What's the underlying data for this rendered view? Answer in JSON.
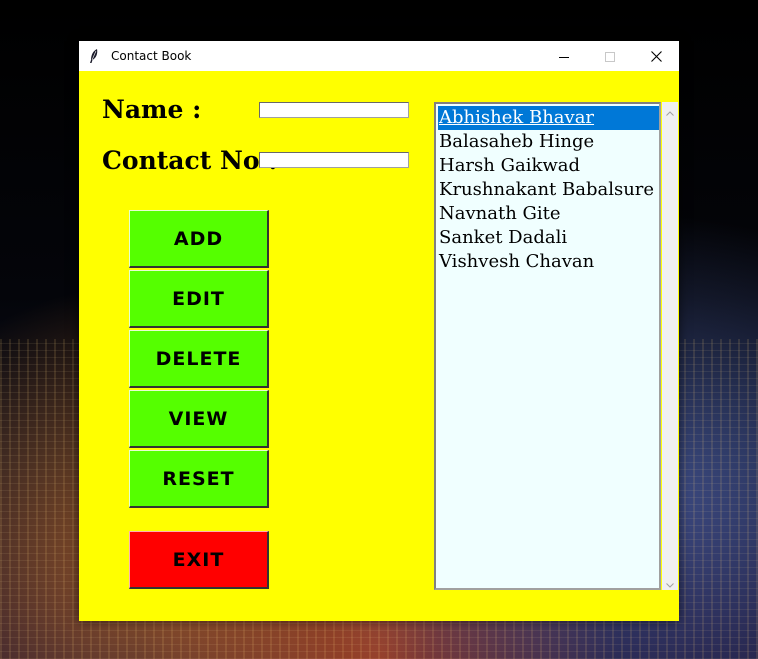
{
  "window": {
    "title": "Contact Book",
    "icon": "feather-icon",
    "controls": {
      "minimize": "minimize-icon",
      "maximize": "maximize-icon",
      "close": "close-icon"
    }
  },
  "form": {
    "name_label": "Name :",
    "name_value": "",
    "contact_label": "Contact No :",
    "contact_value": ""
  },
  "buttons": {
    "add": "ADD",
    "edit": "EDIT",
    "delete": "DELETE",
    "view": "VIEW",
    "reset": "RESET",
    "exit": "EXIT"
  },
  "contacts": {
    "selected_index": 0,
    "items": [
      "Abhishek Bhavar",
      "Balasaheb Hinge",
      "Harsh Gaikwad",
      "Krushnakant Babalsure",
      "Navnath Gite",
      "Sanket Dadali",
      "Vishvesh Chavan"
    ]
  },
  "colors": {
    "window_bg": "#ffff00",
    "action_button": "#55ff00",
    "exit_button": "#ff0000",
    "listbox_bg": "#f0ffff",
    "selection": "#0078d7"
  }
}
